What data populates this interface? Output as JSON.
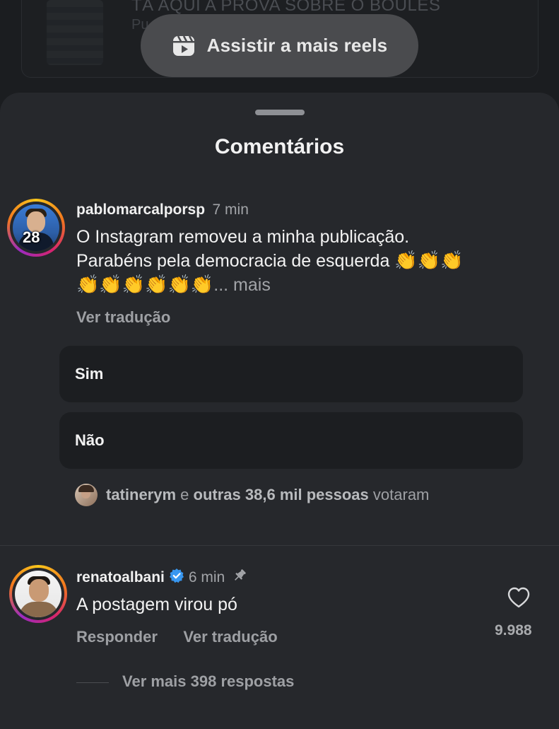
{
  "background": {
    "title": "TÁ AQUI A PROVA SOBRE O BOULES",
    "subtitle_fragment": "Pu"
  },
  "reels_button": {
    "label": "Assistir a mais reels",
    "icon": "reels-icon"
  },
  "sheet": {
    "title": "Comentários"
  },
  "comments": [
    {
      "username": "pablomarcalporsp",
      "time": "7 min",
      "avatar_badge": "28",
      "text_line1": "O Instagram removeu a minha publicação.",
      "text_line2": "Parabéns pela democracia de esquerda",
      "clap_emoji": "👏",
      "more": "... mais",
      "translate": "Ver tradução",
      "poll": {
        "options": [
          "Sim",
          "Não"
        ],
        "voters_user": "tatinerym",
        "voters_and": "e",
        "voters_others": "outras 38,6 mil pessoas",
        "voters_suffix": "votaram"
      }
    },
    {
      "username": "renatoalbani",
      "verified": true,
      "time": "6 min",
      "pinned": true,
      "text": "A postagem virou pó",
      "reply": "Responder",
      "translate": "Ver tradução",
      "likes": "9.988",
      "view_replies": "Ver mais 398 respostas"
    }
  ],
  "colors": {
    "sheet_bg": "#26282c",
    "page_bg": "#1b1d20",
    "verified_blue": "#3897f0",
    "muted_text": "#9ea0a4"
  }
}
